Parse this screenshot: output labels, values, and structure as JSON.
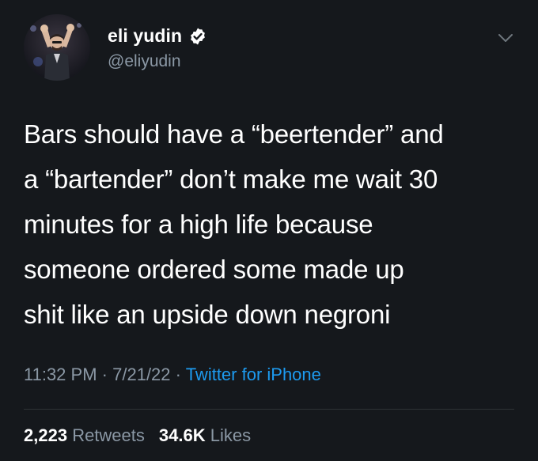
{
  "author": {
    "display_name": "eli yudin",
    "handle": "@eliyudin",
    "verified": true
  },
  "tweet": {
    "text_lines": [
      "Bars should have a “beertender” and",
      "a “bartender” don’t make me wait 30",
      "minutes for a high life because",
      "someone ordered some made up",
      "shit like an upside down negroni"
    ],
    "time": "11:32 PM",
    "date": "7/21/22",
    "separator": "·",
    "source": "Twitter for iPhone"
  },
  "stats": {
    "retweets_count": "2,223",
    "retweets_label": "Retweets",
    "likes_count": "34.6K",
    "likes_label": "Likes"
  },
  "icons": {
    "verified": "verified-badge-icon",
    "menu": "chevron-down-icon"
  },
  "colors": {
    "background": "#15181c",
    "text_primary": "#ffffff",
    "text_secondary": "#8b98a5",
    "link": "#1d9bf0",
    "divider": "#2f3336"
  }
}
